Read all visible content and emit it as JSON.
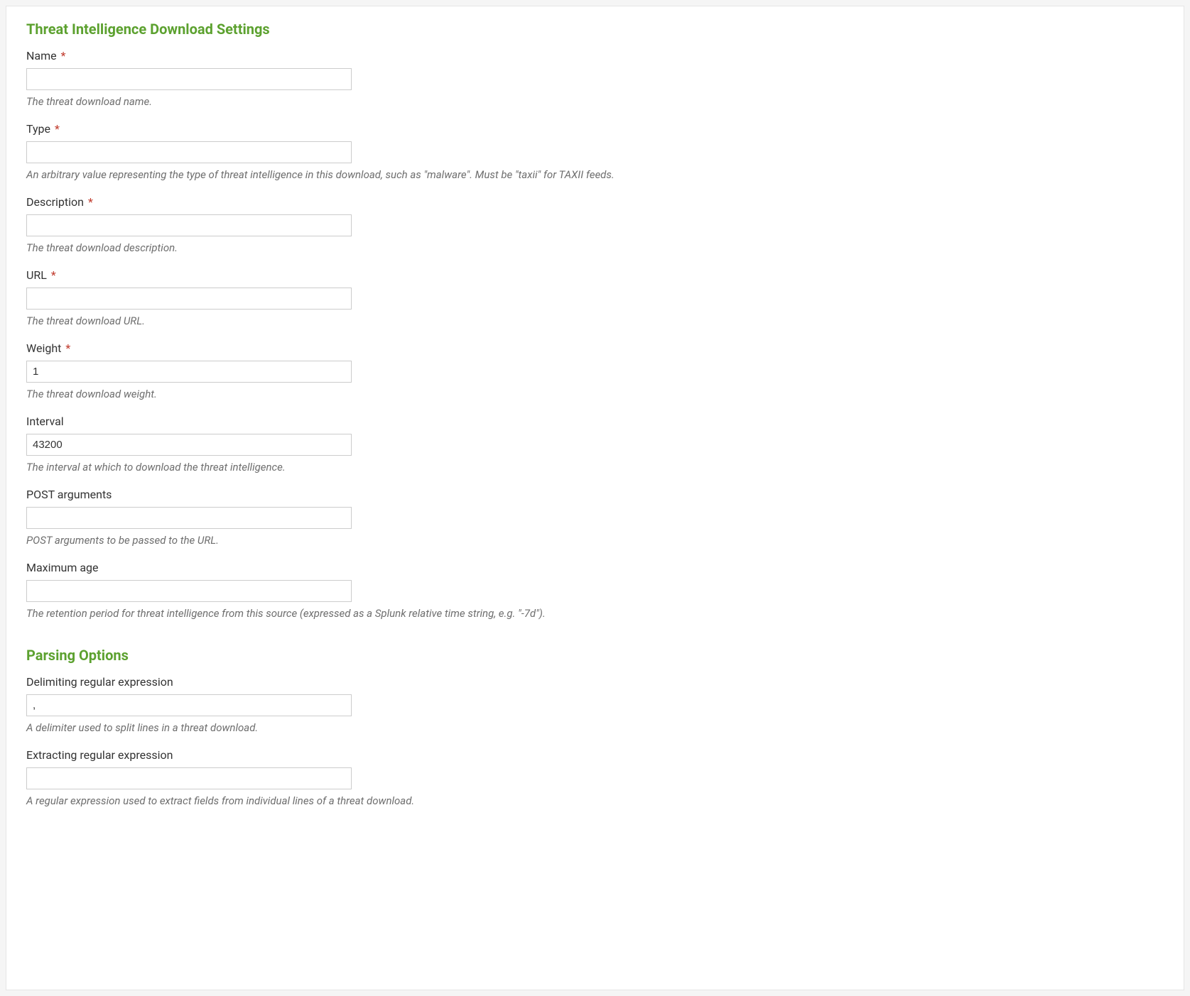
{
  "sections": {
    "threatIntel": {
      "title": "Threat Intelligence Download Settings",
      "fields": {
        "name": {
          "label": "Name",
          "required": "*",
          "value": "",
          "help": "The threat download name."
        },
        "type": {
          "label": "Type",
          "required": "*",
          "value": "",
          "help": "An arbitrary value representing the type of threat intelligence in this download, such as \"malware\". Must be \"taxii\" for TAXII feeds."
        },
        "description": {
          "label": "Description",
          "required": "*",
          "value": "",
          "help": "The threat download description."
        },
        "url": {
          "label": "URL",
          "required": "*",
          "value": "",
          "help": "The threat download URL."
        },
        "weight": {
          "label": "Weight",
          "required": "*",
          "value": "1",
          "help": "The threat download weight."
        },
        "interval": {
          "label": "Interval",
          "value": "43200",
          "help": "The interval at which to download the threat intelligence."
        },
        "postArgs": {
          "label": "POST arguments",
          "value": "",
          "help": "POST arguments to be passed to the URL."
        },
        "maxAge": {
          "label": "Maximum age",
          "value": "",
          "help": "The retention period for threat intelligence from this source (expressed as a Splunk relative time string, e.g. \"-7d\")."
        }
      }
    },
    "parsing": {
      "title": "Parsing Options",
      "fields": {
        "delimiter": {
          "label": "Delimiting regular expression",
          "value": ",",
          "help": "A delimiter used to split lines in a threat download."
        },
        "extracting": {
          "label": "Extracting regular expression",
          "value": "",
          "help": "A regular expression used to extract fields from individual lines of a threat download."
        }
      }
    }
  }
}
